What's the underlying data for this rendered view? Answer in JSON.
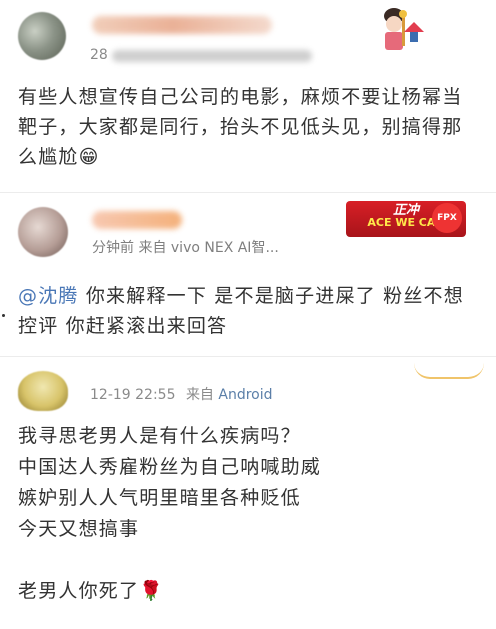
{
  "post1": {
    "time_partial": "28",
    "text": "有些人想宣传自己公司的电影，麻烦不要让杨幂当靶子，大家都是同行，抬头不见低头见，别搞得那么尴尬😁"
  },
  "post2": {
    "meta_partial": "分钟前  来自 vivo NEX AI智...",
    "badge_top": "正冲",
    "badge_bottom": "ACE WE CAN",
    "badge_logo": "FPX",
    "mention": "@沈腾",
    "text": " 你来解释一下 是不是脑子进屎了 粉丝不想控评 你赶紧滚出来回答"
  },
  "post3": {
    "time": "12-19 22:55",
    "from_label": "来自",
    "source": "Android",
    "lines": [
      "我寻思老男人是有什么疾病吗？",
      "中国达人秀雇粉丝为自己呐喊助威",
      "嫉妒别人人气明里暗里各种贬低",
      "今天又想搞事",
      "",
      "老男人你死了🌹"
    ]
  }
}
